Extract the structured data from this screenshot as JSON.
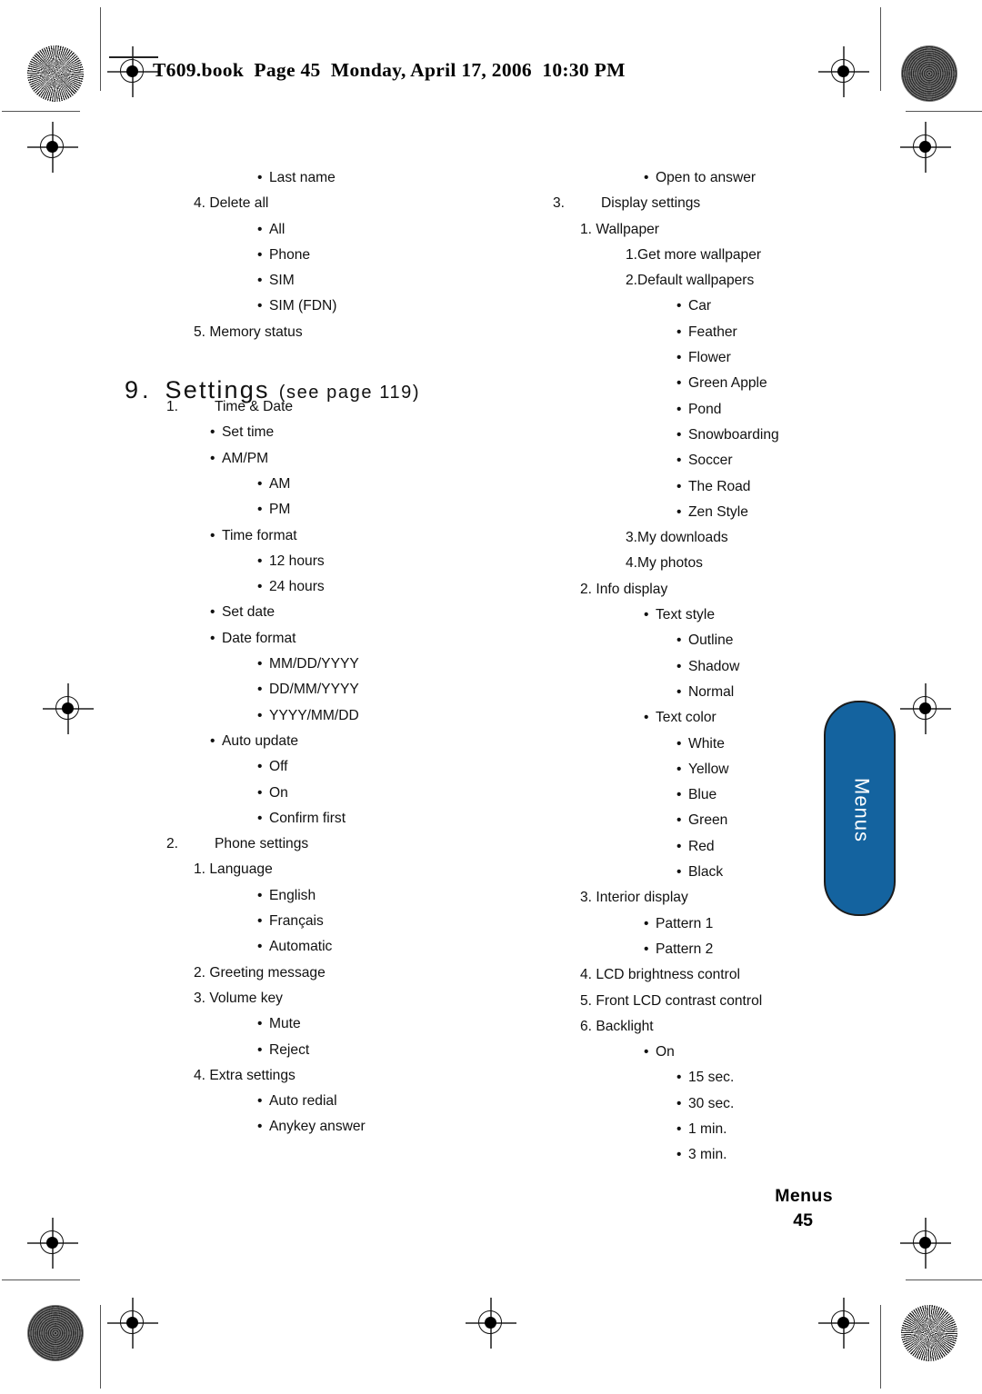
{
  "header": {
    "text": "T609.book  Page 45  Monday, April 17, 2006  10:30 PM"
  },
  "chapter": {
    "number": "9.",
    "title": "Settings",
    "reference": "(see page 119)"
  },
  "side_tab": {
    "label": "Menus",
    "color": "#14639f"
  },
  "footer": {
    "title": "Menus",
    "page": "45"
  },
  "left_column": [
    {
      "level": "b2",
      "bullet": "•",
      "text": "Last name"
    },
    {
      "level": "n2",
      "num": "4.",
      "text": "Delete all"
    },
    {
      "level": "b2",
      "bullet": "•",
      "text": "All"
    },
    {
      "level": "b2",
      "bullet": "•",
      "text": "Phone"
    },
    {
      "level": "b2",
      "bullet": "•",
      "text": "SIM"
    },
    {
      "level": "b2",
      "bullet": "•",
      "text": "SIM (FDN)"
    },
    {
      "level": "n2",
      "num": "5.",
      "text": "Memory status"
    }
  ],
  "left_column_after_heading": [
    {
      "level": "n1",
      "num": "1.",
      "text": "Time & Date"
    },
    {
      "level": "b1",
      "bullet": "•",
      "text": "Set time"
    },
    {
      "level": "b1",
      "bullet": "•",
      "text": "AM/PM"
    },
    {
      "level": "b2",
      "bullet": "•",
      "text": "AM"
    },
    {
      "level": "b2",
      "bullet": "•",
      "text": "PM"
    },
    {
      "level": "b1",
      "bullet": "•",
      "text": "Time format"
    },
    {
      "level": "b2",
      "bullet": "•",
      "text": "12 hours"
    },
    {
      "level": "b2",
      "bullet": "•",
      "text": "24 hours"
    },
    {
      "level": "b1",
      "bullet": "•",
      "text": "Set date"
    },
    {
      "level": "b1",
      "bullet": "•",
      "text": "Date format"
    },
    {
      "level": "b2",
      "bullet": "•",
      "text": "MM/DD/YYYY"
    },
    {
      "level": "b2",
      "bullet": "•",
      "text": "DD/MM/YYYY"
    },
    {
      "level": "b2",
      "bullet": "•",
      "text": "YYYY/MM/DD"
    },
    {
      "level": "b1",
      "bullet": "•",
      "text": "Auto update"
    },
    {
      "level": "b2",
      "bullet": "•",
      "text": "Off"
    },
    {
      "level": "b2",
      "bullet": "•",
      "text": "On"
    },
    {
      "level": "b2",
      "bullet": "•",
      "text": "Confirm first"
    },
    {
      "level": "n1",
      "num": "2.",
      "text": "Phone settings"
    },
    {
      "level": "n2",
      "num": "1.",
      "text": "Language"
    },
    {
      "level": "b2",
      "bullet": "•",
      "text": "English"
    },
    {
      "level": "b2",
      "bullet": "•",
      "text": "Français"
    },
    {
      "level": "b2",
      "bullet": "•",
      "text": "Automatic"
    },
    {
      "level": "n2",
      "num": "2.",
      "text": "Greeting message"
    },
    {
      "level": "n2",
      "num": "3.",
      "text": "Volume key"
    },
    {
      "level": "b2",
      "bullet": "•",
      "text": "Mute"
    },
    {
      "level": "b2",
      "bullet": "•",
      "text": "Reject"
    },
    {
      "level": "n2",
      "num": "4.",
      "text": "Extra settings"
    },
    {
      "level": "b2",
      "bullet": "•",
      "text": "Auto redial"
    },
    {
      "level": "b2",
      "bullet": "•",
      "text": "Anykey answer"
    }
  ],
  "right_column": [
    {
      "level": "b2",
      "bullet": "•",
      "text": "Open to answer"
    },
    {
      "level": "n1",
      "num": "3.",
      "text": "Display settings"
    },
    {
      "level": "n2",
      "num": "1.",
      "text": "Wallpaper"
    },
    {
      "level": "n3",
      "num": "1.",
      "text": "Get more wallpaper"
    },
    {
      "level": "n3",
      "num": "2.",
      "text": "Default wallpapers"
    },
    {
      "level": "b3",
      "bullet": "•",
      "text": "Car"
    },
    {
      "level": "b3",
      "bullet": "•",
      "text": "Feather"
    },
    {
      "level": "b3",
      "bullet": "•",
      "text": "Flower"
    },
    {
      "level": "b3",
      "bullet": "•",
      "text": "Green Apple"
    },
    {
      "level": "b3",
      "bullet": "•",
      "text": "Pond"
    },
    {
      "level": "b3",
      "bullet": "•",
      "text": "Snowboarding"
    },
    {
      "level": "b3",
      "bullet": "•",
      "text": "Soccer"
    },
    {
      "level": "b3",
      "bullet": "•",
      "text": "The Road"
    },
    {
      "level": "b3",
      "bullet": "•",
      "text": "Zen Style"
    },
    {
      "level": "n3",
      "num": "3.",
      "text": "My downloads"
    },
    {
      "level": "n3",
      "num": "4.",
      "text": "My photos"
    },
    {
      "level": "n2",
      "num": "2.",
      "text": "Info display"
    },
    {
      "level": "b2",
      "bullet": "•",
      "text": "Text style"
    },
    {
      "level": "b3",
      "bullet": "•",
      "text": "Outline"
    },
    {
      "level": "b3",
      "bullet": "•",
      "text": "Shadow"
    },
    {
      "level": "b3",
      "bullet": "•",
      "text": "Normal"
    },
    {
      "level": "b2",
      "bullet": "•",
      "text": "Text color"
    },
    {
      "level": "b3",
      "bullet": "•",
      "text": "White"
    },
    {
      "level": "b3",
      "bullet": "•",
      "text": "Yellow"
    },
    {
      "level": "b3",
      "bullet": "•",
      "text": "Blue"
    },
    {
      "level": "b3",
      "bullet": "•",
      "text": "Green"
    },
    {
      "level": "b3",
      "bullet": "•",
      "text": "Red"
    },
    {
      "level": "b3",
      "bullet": "•",
      "text": "Black"
    },
    {
      "level": "n2",
      "num": "3.",
      "text": "Interior display"
    },
    {
      "level": "b2",
      "bullet": "•",
      "text": "Pattern 1"
    },
    {
      "level": "b2",
      "bullet": "•",
      "text": "Pattern 2"
    },
    {
      "level": "n2",
      "num": "4.",
      "text": "LCD brightness control"
    },
    {
      "level": "n2",
      "num": "5.",
      "text": "Front LCD contrast control"
    },
    {
      "level": "n2",
      "num": "6.",
      "text": "Backlight"
    },
    {
      "level": "b2",
      "bullet": "•",
      "text": "On"
    },
    {
      "level": "b3",
      "bullet": "•",
      "text": "15 sec."
    },
    {
      "level": "b3",
      "bullet": "•",
      "text": "30 sec."
    },
    {
      "level": "b3",
      "bullet": "•",
      "text": "1 min."
    },
    {
      "level": "b3",
      "bullet": "•",
      "text": "3 min."
    }
  ]
}
